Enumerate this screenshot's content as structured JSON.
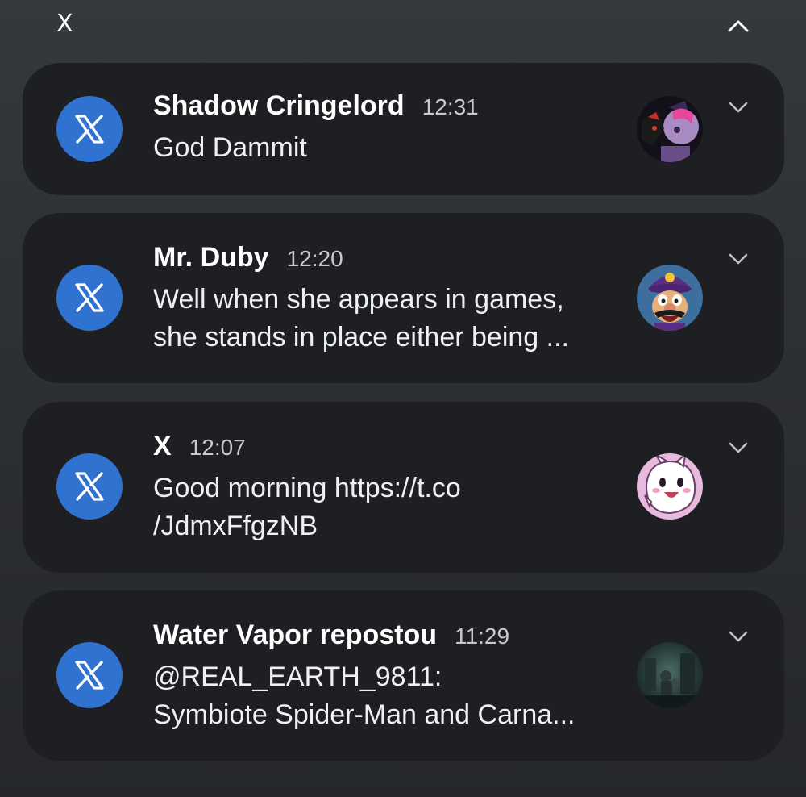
{
  "group": {
    "app_name": "X",
    "collapse_icon": "chevron-up-icon"
  },
  "notifications": [
    {
      "app_icon": "x-logo-icon",
      "sender": "Shadow Cringelord",
      "time": "12:31",
      "message_lines": [
        "God Dammit"
      ],
      "avatar_icon": "avatar-shadow-twilight",
      "expand_icon": "chevron-down-icon"
    },
    {
      "app_icon": "x-logo-icon",
      "sender": "Mr. Duby",
      "time": "12:20",
      "message_lines": [
        "Well when she appears in games,",
        "she stands in place either being ..."
      ],
      "avatar_icon": "avatar-waluigi",
      "expand_icon": "chevron-down-icon"
    },
    {
      "app_icon": "x-logo-icon",
      "sender": "X",
      "time": "12:07",
      "message_lines": [
        "Good morning https://t.co",
        "/JdmxFfgzNB"
      ],
      "avatar_icon": "avatar-pink-ghost",
      "expand_icon": "chevron-down-icon"
    },
    {
      "app_icon": "x-logo-icon",
      "sender": "Water Vapor repostou",
      "time": "11:29",
      "message_lines": [
        "@REAL_EARTH_9811:",
        "Symbiote Spider-Man and Carna..."
      ],
      "avatar_icon": "avatar-dark-scene",
      "expand_icon": "chevron-down-icon"
    }
  ],
  "colors": {
    "background": "#2d3034",
    "card": "#1e1f23",
    "app_icon_bg": "#2f72cf",
    "time_text": "#c8c9cc"
  }
}
